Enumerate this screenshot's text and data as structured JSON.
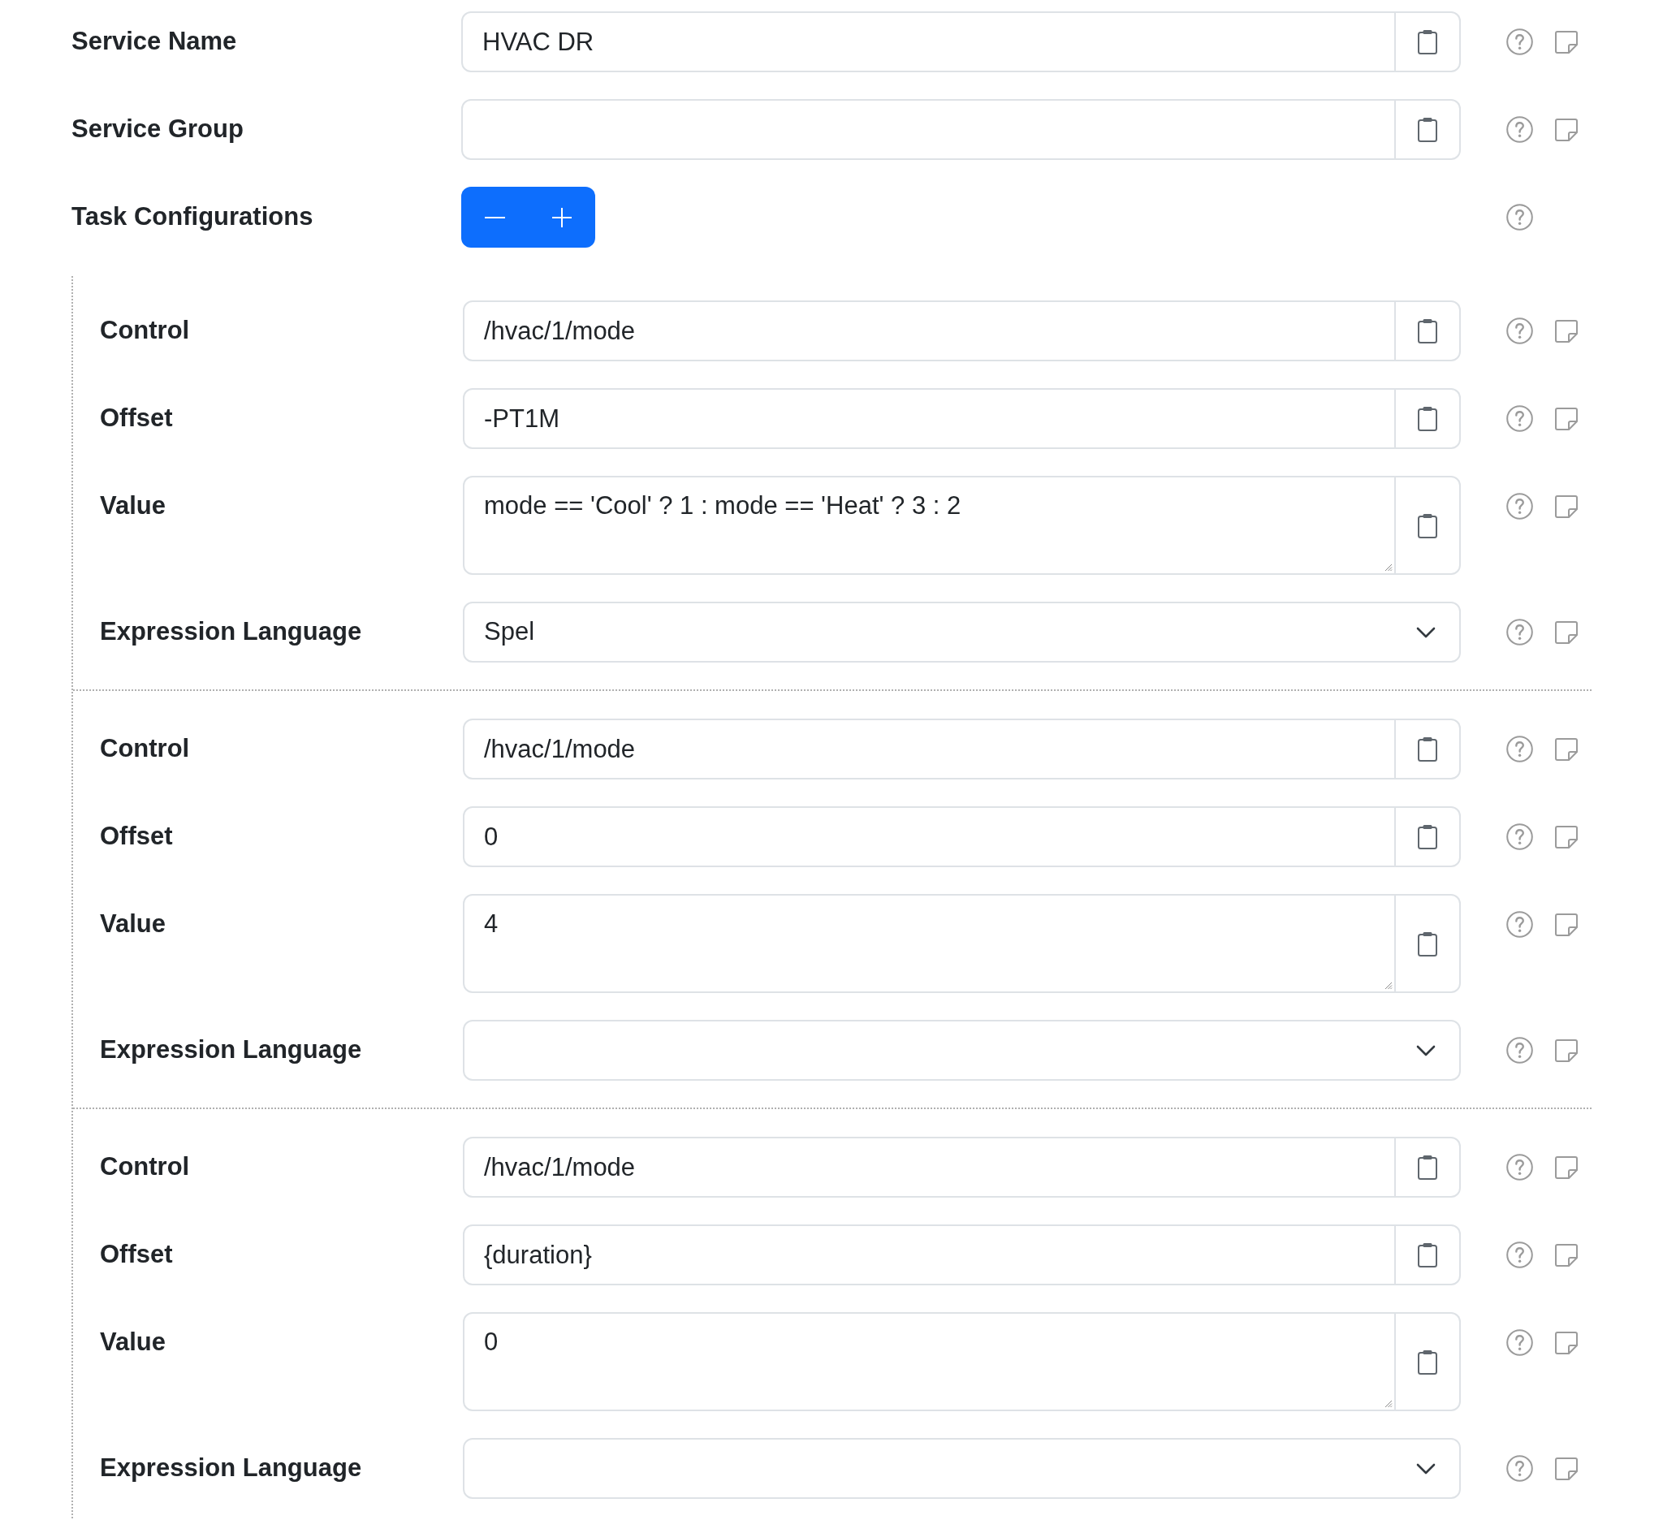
{
  "fields": [
    {
      "kind": "text",
      "label": "Service Name",
      "value": "HVAC DR"
    },
    {
      "kind": "text",
      "label": "Service Group"
    }
  ],
  "task_configurations": {
    "label": "Task Configurations",
    "tasks": [
      {
        "fields": [
          {
            "kind": "text",
            "label": "Control",
            "value": "/hvac/1/mode"
          },
          {
            "kind": "text",
            "label": "Offset",
            "value": "-PT1M"
          },
          {
            "kind": "textarea",
            "label": "Value",
            "value": "mode == 'Cool' ? 1 : mode == 'Heat' ? 3 : 2"
          },
          {
            "kind": "select",
            "label": "Expression Language",
            "value": "Spel"
          }
        ]
      },
      {
        "fields": [
          {
            "kind": "text",
            "label": "Control",
            "value": "/hvac/1/mode"
          },
          {
            "kind": "text",
            "label": "Offset",
            "value": "0"
          },
          {
            "kind": "textarea",
            "label": "Value",
            "value": "4"
          },
          {
            "kind": "select",
            "label": "Expression Language"
          }
        ]
      },
      {
        "fields": [
          {
            "kind": "text",
            "label": "Control",
            "value": "/hvac/1/mode"
          },
          {
            "kind": "text",
            "label": "Offset",
            "value": "{duration}"
          },
          {
            "kind": "textarea",
            "label": "Value",
            "value": "0"
          },
          {
            "kind": "select",
            "label": "Expression Language"
          }
        ]
      }
    ]
  }
}
